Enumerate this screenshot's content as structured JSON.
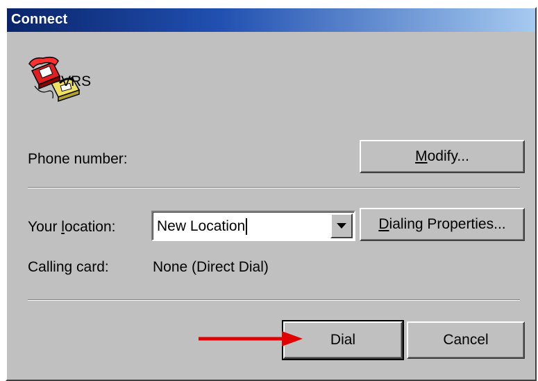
{
  "window": {
    "title": "Connect"
  },
  "connection": {
    "name": "VRS",
    "icon": "phone-icon"
  },
  "phone": {
    "label": "Phone number:"
  },
  "buttons": {
    "modify": {
      "prefix": "",
      "mnemonic": "M",
      "rest": "odify..."
    },
    "dialing_properties": {
      "prefix": "",
      "mnemonic": "D",
      "rest": "ialing Properties..."
    },
    "dial": "Dial",
    "cancel": "Cancel"
  },
  "location": {
    "label_prefix": "Your ",
    "label_mnemonic": "l",
    "label_rest": "ocation:",
    "value": "New Location",
    "dropdown_icon": "chevron-down-icon"
  },
  "calling_card": {
    "label": "Calling card:",
    "value": "None (Direct Dial)"
  },
  "annotation": {
    "arrow_color": "#e00000",
    "points_to": "dial-button"
  },
  "colors": {
    "dialog_bg": "#c0c0c0",
    "title_gradient_start": "#0a246a",
    "title_gradient_end": "#a6caf0"
  }
}
